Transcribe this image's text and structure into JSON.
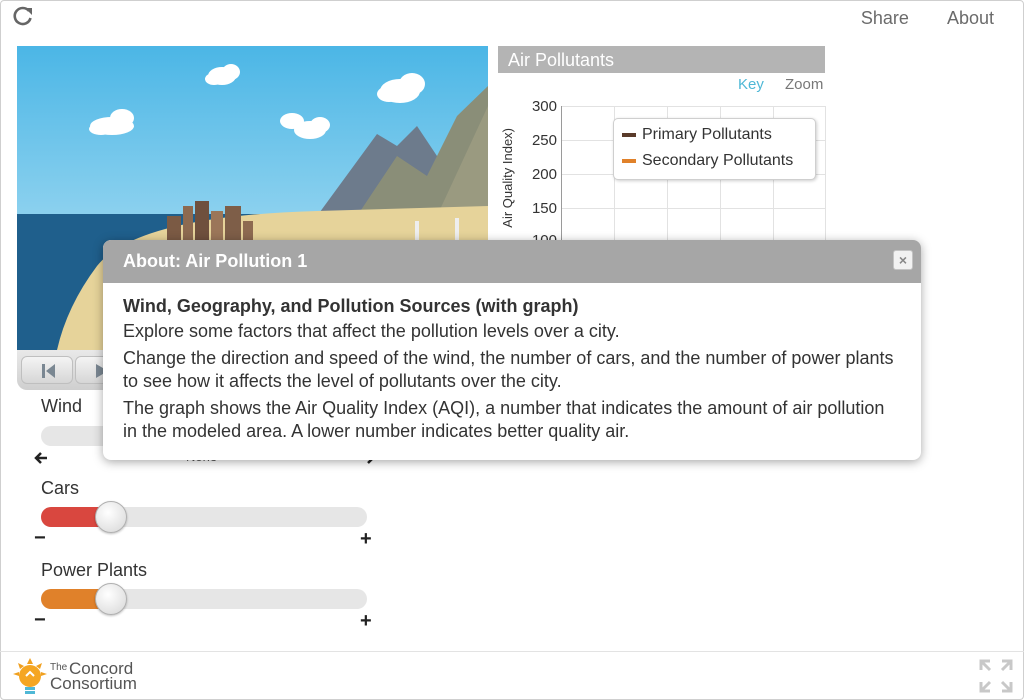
{
  "topnav": {
    "share": "Share",
    "about": "About"
  },
  "controls": {
    "wind": {
      "label": "Wind",
      "value_label": "None"
    },
    "cars": {
      "label": "Cars",
      "minus": "−",
      "plus": "+",
      "level": 0.22
    },
    "power_plants": {
      "label": "Power Plants",
      "minus": "−",
      "plus": "+",
      "level": 0.22
    }
  },
  "graph": {
    "title": "Air Pollutants",
    "key_link": "Key",
    "zoom_link": "Zoom",
    "ylabel": "Air Quality Index)",
    "yticks": [
      "300",
      "250",
      "200",
      "150",
      "100"
    ],
    "legend": [
      {
        "label": "Primary Pollutants",
        "color": "#5a3b2a"
      },
      {
        "label": "Secondary Pollutants",
        "color": "#e0812a"
      }
    ]
  },
  "modal": {
    "title": "About: Air Pollution 1",
    "close": "×",
    "subtitle": "Wind, Geography, and Pollution Sources (with graph)",
    "p1": "Explore some factors that affect the pollution levels over a city.",
    "p2": "Change the direction and speed of the wind, the number of cars, and the number of power plants to see how it affects the level of pollutants over the city.",
    "p3": "The graph shows the Air Quality Index (AQI), a number that indicates the amount of air pollution in the modeled area. A lower number indicates better quality air."
  },
  "footer": {
    "logo_the": "The",
    "logo_concord": "Concord",
    "logo_consortium": "Consortium"
  },
  "colors": {
    "accent_link": "#4fb8d6",
    "cars_fill": "#d9473f",
    "plants_fill": "#e0812a"
  }
}
